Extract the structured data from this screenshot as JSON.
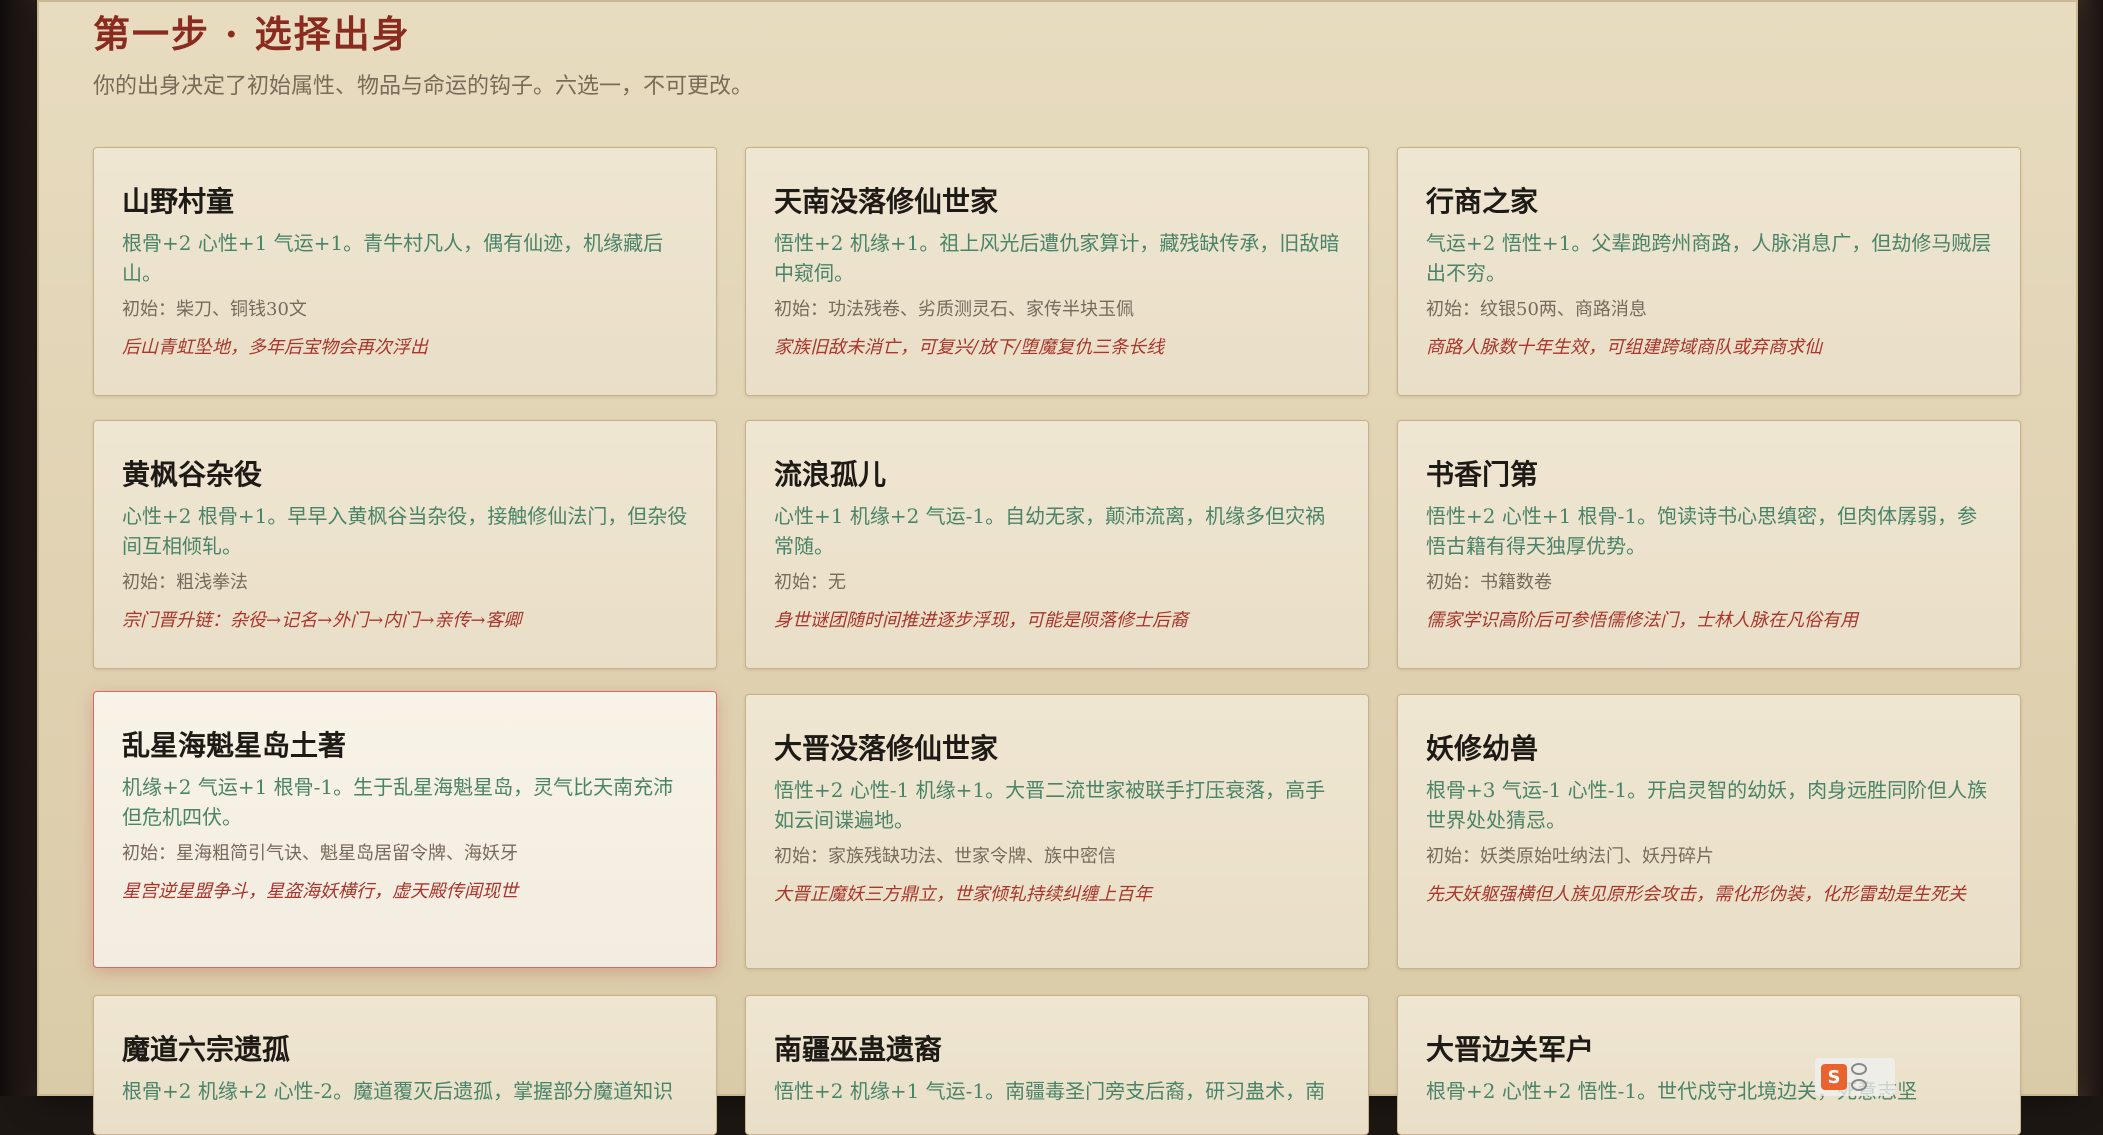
{
  "header": {
    "title": "第一步 · 选择出身",
    "subtitle": "你的出身决定了初始属性、物品与命运的钩子。六选一，不可更改。"
  },
  "cards": [
    {
      "name": "山野村童",
      "desc": "根骨+2 心性+1 气运+1。青牛村凡人，偶有仙迹，机缘藏后山。",
      "items": "初始：柴刀、铜钱30文",
      "hook": "后山青虹坠地，多年后宝物会再次浮出"
    },
    {
      "name": "天南没落修仙世家",
      "desc": "悟性+2 机缘+1。祖上风光后遭仇家算计，藏残缺传承，旧敌暗中窥伺。",
      "items": "初始：功法残卷、劣质测灵石、家传半块玉佩",
      "hook": "家族旧敌未消亡，可复兴/放下/堕魔复仇三条长线"
    },
    {
      "name": "行商之家",
      "desc": "气运+2 悟性+1。父辈跑跨州商路，人脉消息广，但劫修马贼层出不穷。",
      "items": "初始：纹银50两、商路消息",
      "hook": "商路人脉数十年生效，可组建跨域商队或弃商求仙"
    },
    {
      "name": "黄枫谷杂役",
      "desc": "心性+2 根骨+1。早早入黄枫谷当杂役，接触修仙法门，但杂役间互相倾轧。",
      "items": "初始：粗浅拳法",
      "hook": "宗门晋升链：杂役→记名→外门→内门→亲传→客卿"
    },
    {
      "name": "流浪孤儿",
      "desc": "心性+1 机缘+2 气运-1。自幼无家，颠沛流离，机缘多但灾祸常随。",
      "items": "初始：无",
      "hook": "身世谜团随时间推进逐步浮现，可能是陨落修士后裔"
    },
    {
      "name": "书香门第",
      "desc": "悟性+2 心性+1 根骨-1。饱读诗书心思缜密，但肉体孱弱，参悟古籍有得天独厚优势。",
      "items": "初始：书籍数卷",
      "hook": "儒家学识高阶后可参悟儒修法门，士林人脉在凡俗有用"
    },
    {
      "name": "乱星海魁星岛土著",
      "desc": "机缘+2 气运+1 根骨-1。生于乱星海魁星岛，灵气比天南充沛但危机四伏。",
      "items": "初始：星海粗简引气诀、魁星岛居留令牌、海妖牙",
      "hook": "星宫逆星盟争斗，星盗海妖横行，虚天殿传闻现世"
    },
    {
      "name": "大晋没落修仙世家",
      "desc": "悟性+2 心性-1 机缘+1。大晋二流世家被联手打压衰落，高手如云间谍遍地。",
      "items": "初始：家族残缺功法、世家令牌、族中密信",
      "hook": "大晋正魔妖三方鼎立，世家倾轧持续纠缠上百年"
    },
    {
      "name": "妖修幼兽",
      "desc": "根骨+3 气运-1 心性-1。开启灵智的幼妖，肉身远胜同阶但人族世界处处猜忌。",
      "items": "初始：妖类原始吐纳法门、妖丹碎片",
      "hook": "先天妖躯强横但人族见原形会攻击，需化形伪装，化形雷劫是生死关"
    },
    {
      "name": "魔道六宗遗孤",
      "desc": "根骨+2 机缘+2 心性-2。魔道覆灭后遗孤，掌握部分魔道知识",
      "items": "",
      "hook": ""
    },
    {
      "name": "南疆巫蛊遗裔",
      "desc": "悟性+2 机缘+1 气运-1。南疆毒圣门旁支后裔，研习蛊术，南",
      "items": "",
      "hook": ""
    },
    {
      "name": "大晋边关军户",
      "desc": "根骨+2 心性+2 悟性-1。世代戍守北境边关，死意志坚",
      "items": "",
      "hook": ""
    }
  ],
  "selected_index": 6,
  "watermark": {
    "letter": "S"
  },
  "colors": {
    "title": "#8b2a1f",
    "stats": "#4a8468",
    "hook": "#a8362c",
    "selected_border": "#d46b66"
  }
}
